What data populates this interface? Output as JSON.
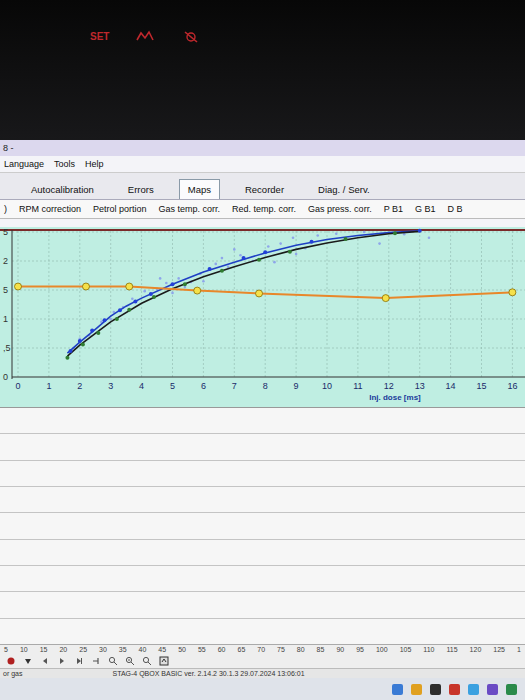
{
  "dashboard": {
    "label": "SET",
    "color": "#c0282d"
  },
  "window": {
    "title": "8 -"
  },
  "menu": [
    "Language",
    "Tools",
    "Help"
  ],
  "tabs": [
    {
      "label": "Autocalibration",
      "selected": false
    },
    {
      "label": "Errors",
      "selected": false
    },
    {
      "label": "Maps",
      "selected": true
    },
    {
      "label": "Recorder",
      "selected": false
    },
    {
      "label": "Diag. / Serv.",
      "selected": false
    }
  ],
  "subtabs": [
    {
      "label": ")",
      "selected": false
    },
    {
      "label": "RPM correction",
      "selected": false
    },
    {
      "label": "Petrol portion",
      "selected": false
    },
    {
      "label": "Gas temp. corr.",
      "selected": false
    },
    {
      "label": "Red. temp. corr.",
      "selected": false
    },
    {
      "label": "Gas press. corr.",
      "selected": false
    },
    {
      "label": "P B1",
      "selected": false
    },
    {
      "label": "G B1",
      "selected": false
    },
    {
      "label": "D B",
      "selected": false
    }
  ],
  "chart": {
    "y_ticks": [
      {
        "label": "5",
        "value": 2.5
      },
      {
        "label": "2",
        "value": 2
      },
      {
        "label": "5",
        "value": 1.5
      },
      {
        "label": "1",
        "value": 1
      },
      {
        "label": ",5",
        "value": 0.5
      },
      {
        "label": "0",
        "value": 0
      }
    ],
    "x_ticks": [
      "0",
      "1",
      "2",
      "3",
      "4",
      "5",
      "6",
      "7",
      "8",
      "9",
      "10",
      "11",
      "12",
      "13",
      "14",
      "15",
      "16"
    ],
    "x_title": "Inj. dose [ms]",
    "series": [
      {
        "kind": "faint-points",
        "color": "#8ea6ea",
        "points": [
          [
            1.8,
            0.5
          ],
          [
            2.3,
            0.72
          ],
          [
            2.7,
            0.95
          ],
          [
            3.1,
            1.12
          ],
          [
            3.4,
            1.2
          ],
          [
            3.7,
            1.35
          ],
          [
            4.1,
            1.48
          ],
          [
            4.5,
            1.52
          ],
          [
            4.8,
            1.62
          ],
          [
            5.2,
            1.7
          ],
          [
            5.6,
            1.64
          ],
          [
            5.9,
            1.78
          ],
          [
            6.4,
            1.95
          ],
          [
            6.8,
            1.9
          ],
          [
            7.2,
            2.1
          ],
          [
            7.6,
            2.0
          ],
          [
            8.1,
            2.25
          ],
          [
            8.5,
            2.3
          ],
          [
            8.9,
            2.4
          ],
          [
            9.3,
            2.22
          ],
          [
            9.7,
            2.44
          ],
          [
            10.3,
            2.47
          ],
          [
            11.2,
            2.5
          ],
          [
            12.5,
            2.46
          ],
          [
            4.6,
            1.7
          ],
          [
            5.0,
            1.45
          ],
          [
            6.0,
            1.65
          ],
          [
            7.0,
            2.2
          ],
          [
            8.3,
            1.98
          ],
          [
            3.0,
            1.0
          ],
          [
            2.0,
            0.66
          ],
          [
            5.4,
            1.55
          ],
          [
            6.6,
            2.05
          ],
          [
            9.0,
            2.12
          ],
          [
            11.7,
            2.3
          ],
          [
            13.3,
            2.4
          ]
        ]
      },
      {
        "kind": "line",
        "color": "#1f3fc4",
        "points": [
          [
            1.6,
            0.41
          ],
          [
            2,
            0.6
          ],
          [
            2.5,
            0.82
          ],
          [
            3,
            1.05
          ],
          [
            3.5,
            1.22
          ],
          [
            4,
            1.36
          ],
          [
            5,
            1.6
          ],
          [
            6,
            1.81
          ],
          [
            7,
            1.98
          ],
          [
            8,
            2.14
          ],
          [
            9,
            2.27
          ],
          [
            10,
            2.37
          ],
          [
            11,
            2.44
          ],
          [
            12,
            2.49
          ],
          [
            13,
            2.52
          ]
        ]
      },
      {
        "kind": "line",
        "color": "#1a1a1a",
        "points": [
          [
            1.6,
            0.36
          ],
          [
            2,
            0.55
          ],
          [
            3,
            0.95
          ],
          [
            4,
            1.27
          ],
          [
            5,
            1.52
          ],
          [
            6,
            1.73
          ],
          [
            7,
            1.9
          ],
          [
            8,
            2.06
          ],
          [
            9,
            2.2
          ],
          [
            10,
            2.31
          ],
          [
            11,
            2.4
          ],
          [
            12,
            2.47
          ],
          [
            13,
            2.51
          ]
        ]
      },
      {
        "kind": "points",
        "color": "#2340d8",
        "points": [
          [
            1.7,
            0.45
          ],
          [
            2,
            0.62
          ],
          [
            2.4,
            0.8
          ],
          [
            2.8,
            0.98
          ],
          [
            3.3,
            1.15
          ],
          [
            3.8,
            1.3
          ],
          [
            4.3,
            1.43
          ],
          [
            5,
            1.6
          ],
          [
            6.2,
            1.86
          ],
          [
            7.3,
            2.05
          ],
          [
            8,
            2.15
          ],
          [
            9.5,
            2.33
          ],
          [
            13,
            2.52
          ]
        ]
      },
      {
        "kind": "points",
        "color": "#2f7d32",
        "points": [
          [
            1.6,
            0.33
          ],
          [
            2.1,
            0.56
          ],
          [
            2.6,
            0.76
          ],
          [
            3.2,
            1.0
          ],
          [
            3.6,
            1.16
          ],
          [
            4.4,
            1.38
          ],
          [
            5.4,
            1.6
          ],
          [
            6.6,
            1.83
          ],
          [
            7.8,
            2.02
          ],
          [
            8.8,
            2.16
          ],
          [
            10.6,
            2.38
          ],
          [
            12.2,
            2.48
          ]
        ]
      },
      {
        "kind": "line-markers",
        "color": "#e8872a",
        "marker_color": "#f5e14a",
        "points": [
          [
            0,
            1.56
          ],
          [
            2.2,
            1.56
          ],
          [
            3.6,
            1.56
          ],
          [
            5.8,
            1.49
          ],
          [
            7.8,
            1.44
          ],
          [
            11.9,
            1.36
          ],
          [
            16,
            1.46
          ]
        ]
      }
    ]
  },
  "scale": [
    "5",
    "10",
    "15",
    "20",
    "25",
    "30",
    "35",
    "40",
    "45",
    "50",
    "55",
    "60",
    "65",
    "70",
    "75",
    "80",
    "85",
    "90",
    "95",
    "100",
    "105",
    "110",
    "115",
    "120",
    "125",
    "1"
  ],
  "status": {
    "left": "or gas",
    "text": "STAG-4 QBOX BASIC ver. 2.14.2 30.1.3 29.07.2024 13:06:01"
  }
}
